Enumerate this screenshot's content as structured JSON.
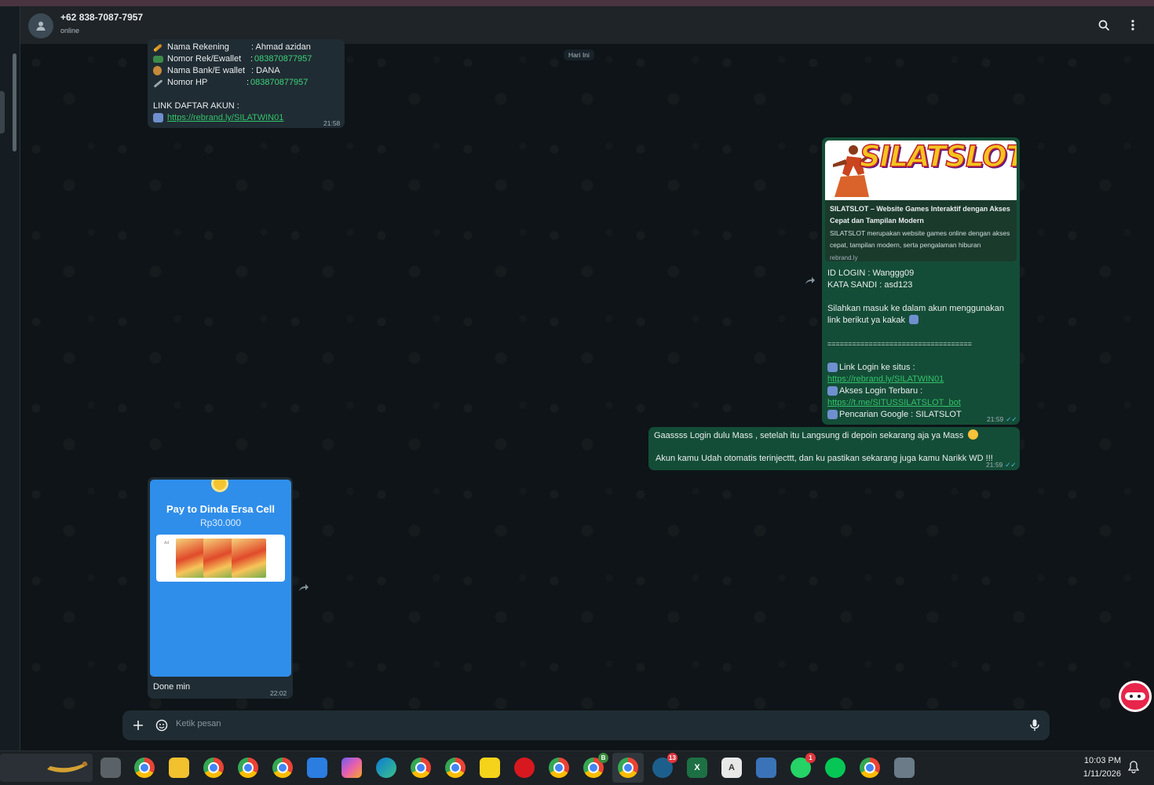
{
  "header": {
    "contact_name": "+62 838-7087-7957",
    "status": "online"
  },
  "chat": {
    "date_chip": "Hari Ini",
    "msg1": {
      "rows": [
        {
          "icon": "pencil-icon",
          "label": "Nama Rekening",
          "value": ": Ahmad azidan"
        },
        {
          "icon": "money-icon",
          "label": "Nomor Rek/Ewallet",
          "value_prefix": ": ",
          "value": "083870877957"
        },
        {
          "icon": "money-bag-icon",
          "label": "Nama Bank/E wallet",
          "value": ": DANA"
        },
        {
          "icon": "syringe-icon",
          "label": "Nomor HP",
          "value_prefix": ": ",
          "value": "083870877957"
        }
      ],
      "link_heading": "LINK DAFTAR AKUN :",
      "link": "https://rebrand.ly/SILATWIN01",
      "time": "21:58"
    },
    "msg2": {
      "preview": {
        "logo_text": "SILATSLOT",
        "title": "SILATSLOT – Website Games Interaktif dengan Akses Cepat dan Tampilan Modern",
        "description": "SILATSLOT merupakan website games online dengan akses cepat, tampilan modern, serta pengalaman hiburan",
        "domain": "rebrand.ly"
      },
      "id_login": "ID LOGIN : Wanggg09",
      "password": "KATA SANDI : asd123",
      "instruction": "Silahkan masuk ke dalam akun menggunakan link berikut ya kakak",
      "separator": "===================================",
      "login_label": "Link Login ke situs  :",
      "login_link": "https://rebrand.ly/SILATWIN01",
      "access_label": "Akses Login Terbaru :",
      "access_link": "https://t.me/SITUSSILATSLOT_bot",
      "search_label": "Pencarian Google : SILATSLOT",
      "time": "21:59"
    },
    "msg3": {
      "line1": "Gaassss Login dulu Mass  , setelah itu Langsung di depoin sekarang aja ya Mass",
      "line2": "Akun kamu Udah otomatis terinjecttt, dan ku pastikan sekarang juga kamu Narikk WD !!!",
      "time": "21:59"
    },
    "msg4": {
      "pay_title": "Pay to Dinda Ersa Cell",
      "pay_amount": "Rp30.000",
      "ad_label": "Ad",
      "caption": "Done min",
      "time": "22:02"
    }
  },
  "composer": {
    "placeholder": "Ketik pesan"
  },
  "taskbar": {
    "time": "10:03 PM",
    "date": "1/11/2026",
    "badges": {
      "teams": "13",
      "chrome_b": "B",
      "whatsapp": "1"
    },
    "excel_letter": "X",
    "word_letter": "A"
  },
  "colors": {
    "outgoing_bubble": "#144d37",
    "incoming_bubble": "#202c33",
    "link": "#53bdeb",
    "pay_card": "#2f8eea"
  }
}
